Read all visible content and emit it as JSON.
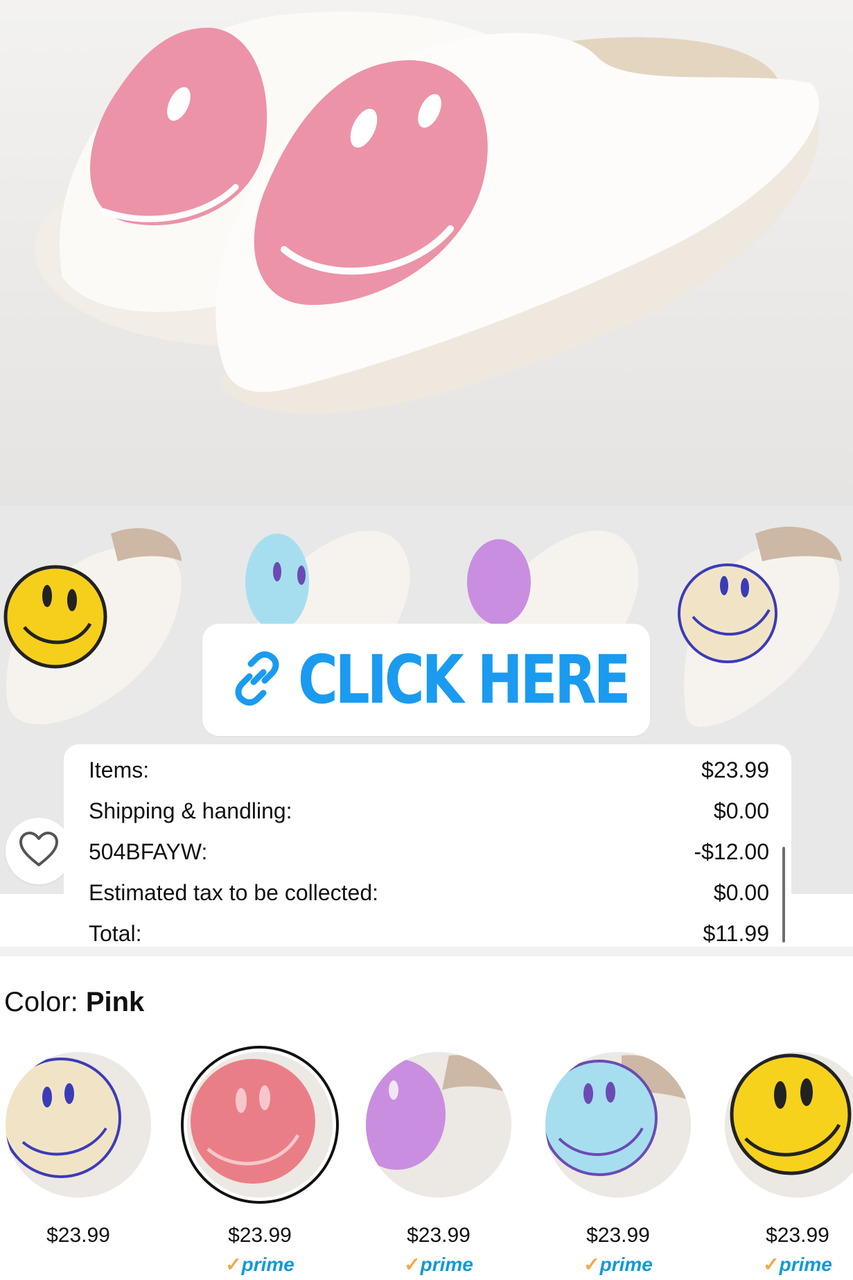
{
  "link_sticker": {
    "label": "CLICK HERE",
    "icon": "link-icon"
  },
  "order_summary": {
    "rows": [
      {
        "label": "Items:",
        "value": "$23.99"
      },
      {
        "label": "Shipping & handling:",
        "value": "$0.00"
      },
      {
        "label": "504BFAYW:",
        "value": "-$12.00"
      },
      {
        "label": "Estimated tax to be collected:",
        "value": "$0.00"
      },
      {
        "label": "Total:",
        "value": "$11.99"
      }
    ]
  },
  "wishlist": {
    "icon": "heart-outline-icon"
  },
  "color_selector": {
    "label": "Color:",
    "selected": "Pink",
    "options": [
      {
        "color": "#f1e4c6",
        "price": "$23.99",
        "prime": ""
      },
      {
        "color": "#ea7e86",
        "price": "$23.99",
        "prime": "prime"
      },
      {
        "color": "#c98ee0",
        "price": "$23.99",
        "prime": "prime"
      },
      {
        "color": "#a6def0",
        "price": "$23.99",
        "prime": "prime"
      },
      {
        "color": "#f6d21d",
        "price": "$23.99",
        "prime": "prime"
      }
    ]
  },
  "colors": {
    "accent_link": "#1a9bf0",
    "prime_blue": "#1399d5",
    "prime_check": "#f3a847",
    "hero_smiley": "#ec93a8"
  }
}
